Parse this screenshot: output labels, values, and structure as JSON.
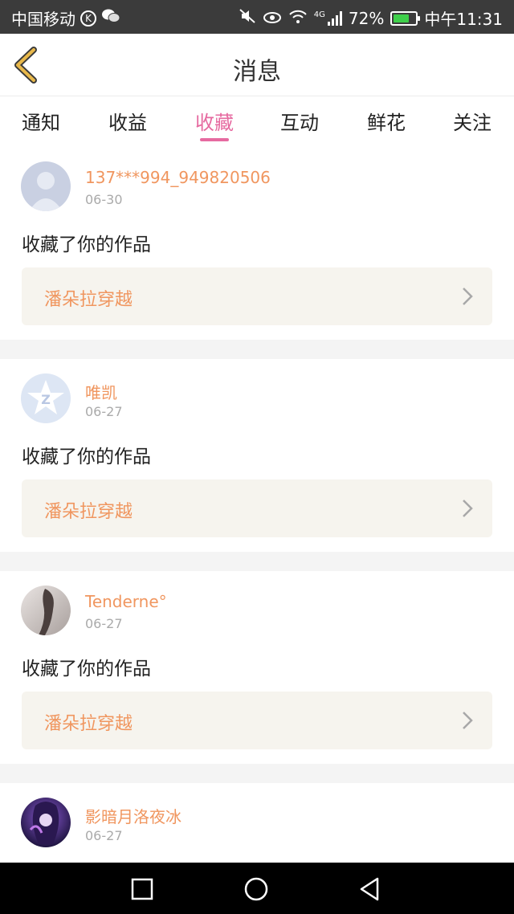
{
  "status_bar": {
    "carrier": "中国移动",
    "carrier_badge": "K",
    "network": "4G",
    "battery": "72%",
    "battery_level": 0.72,
    "time": "中午11:31"
  },
  "header": {
    "title": "消息"
  },
  "tabs": [
    {
      "label": "通知"
    },
    {
      "label": "收益"
    },
    {
      "label": "收藏"
    },
    {
      "label": "互动"
    },
    {
      "label": "鲜花"
    },
    {
      "label": "关注"
    }
  ],
  "active_tab": "收藏",
  "feed": [
    {
      "user": "137***994_949820506",
      "date": "06-30",
      "action": "收藏了你的作品",
      "work": "潘朵拉穿越",
      "avatar": "default-avatar"
    },
    {
      "user": "唯凯",
      "date": "06-27",
      "action": "收藏了你的作品",
      "work": "潘朵拉穿越",
      "avatar": "qq-avatar"
    },
    {
      "user": "Tenderne°",
      "date": "06-27",
      "action": "收藏了你的作品",
      "work": "潘朵拉穿越",
      "avatar": "photo-avatar"
    },
    {
      "user": "影暗月洛夜冰",
      "date": "06-27",
      "action": "",
      "work": "",
      "avatar": "anime-avatar"
    }
  ],
  "colors": {
    "accent": "#e66aa0",
    "username": "#f0965f",
    "status_bar": "#3b3b3b",
    "back_arrow": "#e8b84b"
  }
}
